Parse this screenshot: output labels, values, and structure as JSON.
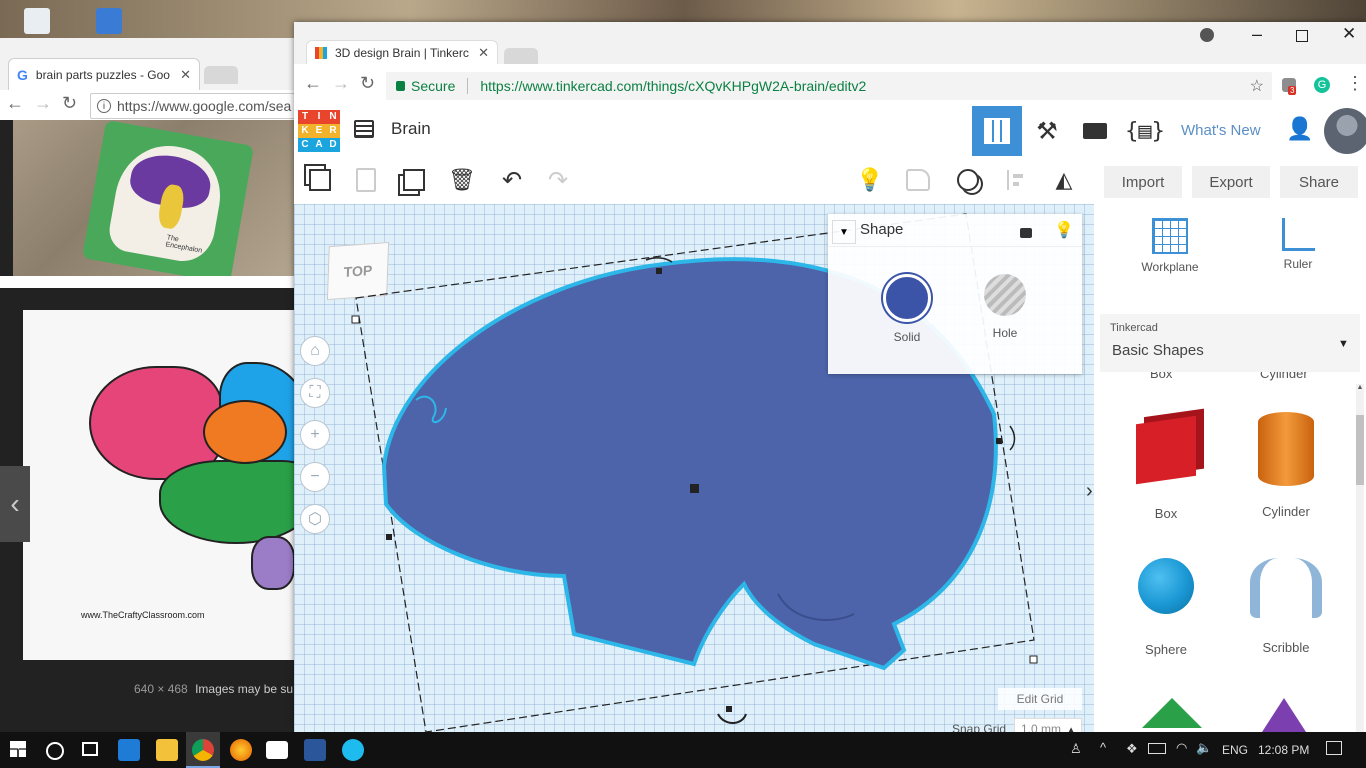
{
  "back_browser": {
    "tab_title": "brain parts puzzles - Goo",
    "url": "https://www.google.com/sea",
    "image2_watermark": "www.TheCraftyClassroom.com",
    "image1_caption": "The Encephalon",
    "image_dimensions": "640 × 468",
    "image_note": "Images may be su"
  },
  "chrome": {
    "tab_title": "3D design Brain | Tinkerc",
    "secure_label": "Secure",
    "url": "https://www.tinkercad.com/things/cXQvKHPgW2A-brain/editv2",
    "extension_badge": "3"
  },
  "tinkercad": {
    "logo_letters": [
      "T",
      "I",
      "N",
      "K",
      "E",
      "R",
      "C",
      "A",
      "D"
    ],
    "design_title": "Brain",
    "whats_new": "What's New",
    "import_label": "Import",
    "export_label": "Export",
    "share_label": "Share",
    "viewcube_label": "TOP",
    "inspector": {
      "title": "Shape",
      "solid_label": "Solid",
      "hole_label": "Hole"
    },
    "edit_grid_label": "Edit Grid",
    "snap_grid_label": "Snap Grid",
    "snap_grid_value": "1.0 mm",
    "workplane_label": "Workplane",
    "ruler_label": "Ruler",
    "library_provider": "Tinkercad",
    "library_category": "Basic Shapes",
    "cut_row": [
      "Box",
      "Cylinder"
    ],
    "shapes": [
      {
        "label": "Box",
        "color": "#d61f26"
      },
      {
        "label": "Cylinder",
        "color": "#e67e18"
      },
      {
        "label": "Sphere",
        "color": "#1a97d4"
      },
      {
        "label": "Scribble",
        "color": "#8fb6d8"
      }
    ]
  },
  "taskbar": {
    "language": "ENG",
    "time": "12:08 PM"
  }
}
